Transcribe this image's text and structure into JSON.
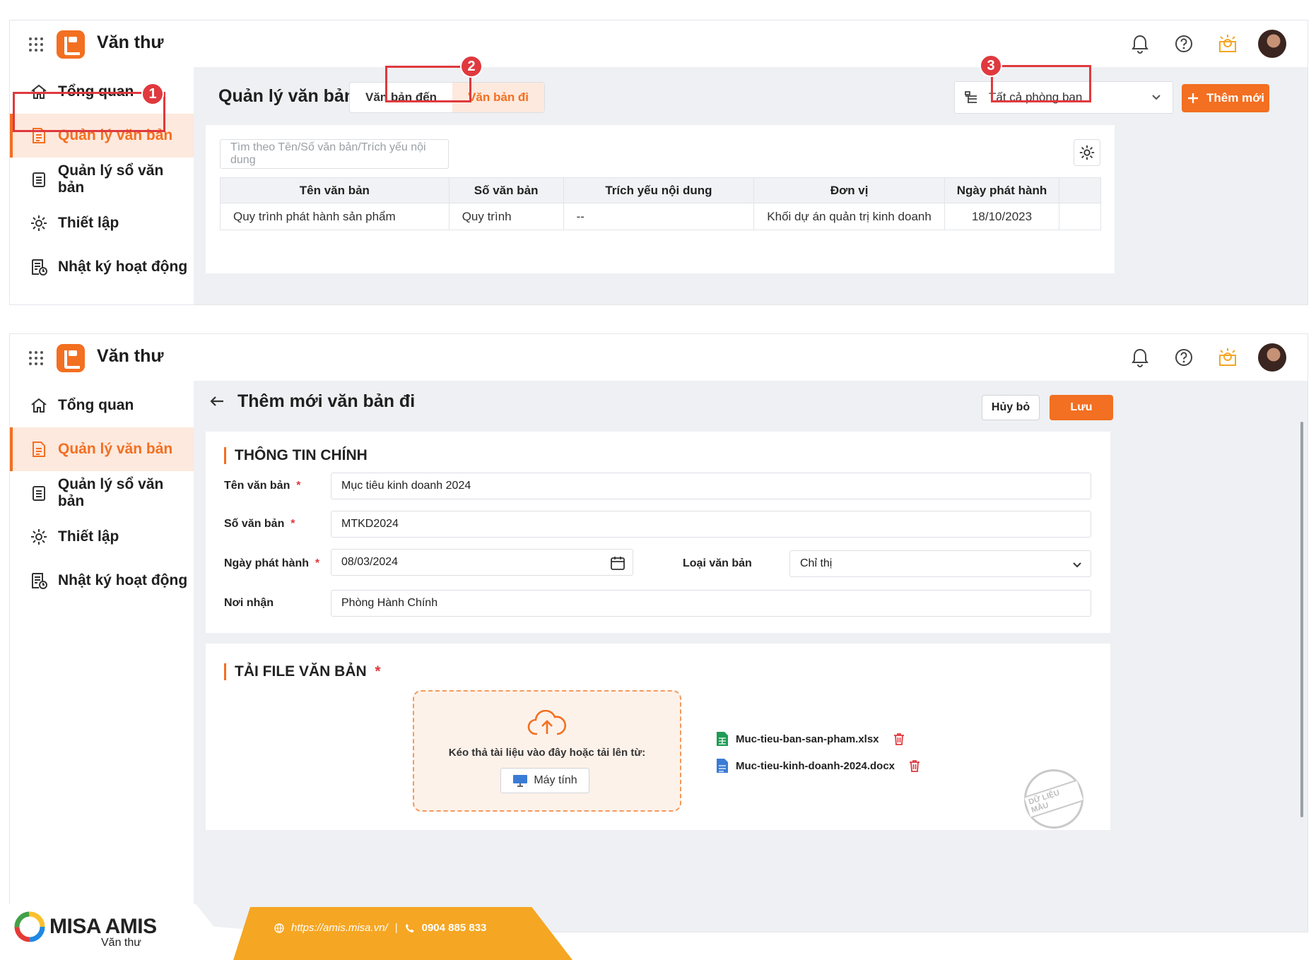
{
  "app": {
    "title": "Văn thư"
  },
  "sidebar": {
    "items": [
      {
        "label": "Tổng quan",
        "icon": "home-icon"
      },
      {
        "label": "Quản lý văn bản",
        "icon": "document-icon"
      },
      {
        "label": "Quản lý sổ văn bản",
        "icon": "clipboard-icon"
      },
      {
        "label": "Thiết lập",
        "icon": "gear-icon"
      },
      {
        "label": "Nhật ký hoạt động",
        "icon": "activity-log-icon"
      }
    ]
  },
  "screen1": {
    "page_title": "Quản lý văn bản",
    "tabs": [
      {
        "label": "Văn bản đến"
      },
      {
        "label": "Văn bản đi"
      }
    ],
    "dept_select": "Tất cả phòng ban",
    "add_button": "Thêm mới",
    "search_placeholder": "Tìm theo Tên/Số văn bản/Trích yếu nội dung",
    "table": {
      "headers": [
        "Tên văn bản",
        "Số văn bản",
        "Trích yếu nội dung",
        "Đơn vị",
        "Ngày phát hành"
      ],
      "rows": [
        [
          "Quy trình phát hành sản phẩm",
          "Quy trình",
          "--",
          "Khối dự án quản trị kinh doanh",
          "18/10/2023"
        ]
      ]
    },
    "badges": [
      "1",
      "2",
      "3"
    ]
  },
  "screen2": {
    "page_title": "Thêm mới văn bản đi",
    "cancel_button": "Hủy bỏ",
    "save_button": "Lưu",
    "section_main": "THÔNG TIN CHÍNH",
    "fields": {
      "name": {
        "label": "Tên văn bản",
        "value": "Mục tiêu kinh doanh 2024"
      },
      "number": {
        "label": "Số văn bản",
        "value": "MTKD2024"
      },
      "date": {
        "label": "Ngày phát hành",
        "value": "08/03/2024"
      },
      "type": {
        "label": "Loại văn bản",
        "value": "Chỉ thị"
      },
      "recipient": {
        "label": "Nơi nhận",
        "value": "Phòng Hành Chính"
      }
    },
    "section_upload": "TẢI FILE VĂN BẢN",
    "dropzone_text": "Kéo thả tài liệu vào đây hoặc tải lên từ:",
    "computer_button": "Máy tính",
    "files": [
      {
        "name": "Muc-tieu-ban-san-pham.xlsx",
        "icon": "spreadsheet-icon"
      },
      {
        "name": "Muc-tieu-kinh-doanh-2024.docx",
        "icon": "word-doc-icon"
      }
    ],
    "stamp": "DỮ LIỆU MẪU"
  },
  "footer": {
    "brand": "MISA AMIS",
    "brand_sub": "Văn thư",
    "url": "https://amis.misa.vn/",
    "separator": "|",
    "phone": "0904 885 833"
  },
  "colors": {
    "accent": "#f36f21",
    "highlight": "#e0393e",
    "footer": "#f5a623"
  }
}
